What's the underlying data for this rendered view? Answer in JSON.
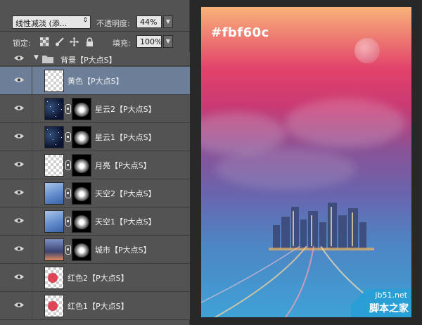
{
  "toolbar": {
    "blend_mode": "线性减淡 (添...",
    "opacity_label": "不透明度:",
    "opacity_value": "44%",
    "lock_label": "锁定:",
    "fill_label": "填充:",
    "fill_value": "100%"
  },
  "group": {
    "name": "背景【P大点S】"
  },
  "layers": [
    {
      "name": "黄色【P大点S】",
      "selected": true,
      "thumb": "checker",
      "mask": false,
      "link": false
    },
    {
      "name": "星云2【P大点S】",
      "selected": false,
      "thumb": "stars",
      "mask": true,
      "link": true
    },
    {
      "name": "星云1【P大点S】",
      "selected": false,
      "thumb": "stars",
      "mask": true,
      "link": true
    },
    {
      "name": "月亮【P大点S】",
      "selected": false,
      "thumb": "checker",
      "mask": true,
      "link": true
    },
    {
      "name": "天空2【P大点S】",
      "selected": false,
      "thumb": "sky",
      "mask": true,
      "link": true
    },
    {
      "name": "天空1【P大点S】",
      "selected": false,
      "thumb": "sky",
      "mask": true,
      "link": true
    },
    {
      "name": "城市【P大点S】",
      "selected": false,
      "thumb": "city",
      "mask": true,
      "link": true
    },
    {
      "name": "红色2【P大点S】",
      "selected": false,
      "thumb": "red",
      "mask": false,
      "link": false
    },
    {
      "name": "红色1【P大点S】",
      "selected": false,
      "thumb": "red",
      "mask": false,
      "link": false
    }
  ],
  "canvas": {
    "color_label": "#fbf60c",
    "watermark_line1": "jb51.net",
    "watermark_line2": "脚本之家"
  },
  "colors": {
    "panel_bg": "#535353",
    "selected_row": "#6d7f98",
    "watermark_bg": "#2a9fd6"
  }
}
